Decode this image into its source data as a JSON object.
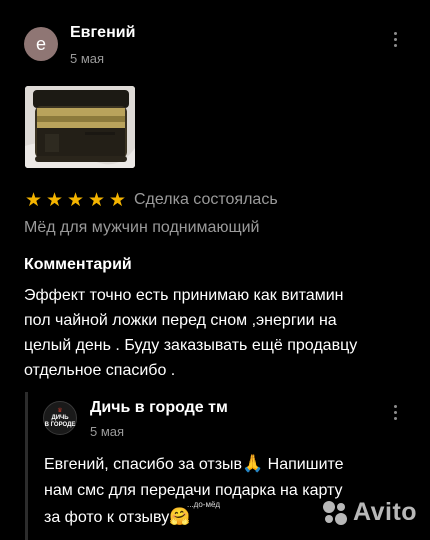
{
  "review": {
    "avatar_letter": "е",
    "author": "Евгений",
    "date": "5 мая",
    "rating": 5,
    "deal_status": "Сделка состоялась",
    "product": "Мёд для мужчин поднимающий",
    "comment_heading": "Комментарий",
    "comment_lines": [
      "Эффект точно есть принимаю как витамин",
      "пол чайной ложки перед сном ,энергии на",
      "целый день . Буду заказывать ещё продавцу",
      "отдельное спасибо ."
    ]
  },
  "reply": {
    "seller_logo_line1": "ДИЧЬ",
    "seller_logo_line2": "В ГОРОДЕ",
    "seller_name": "Дичь в городе тм",
    "date": "5 мая",
    "lines": [
      "Евгений, спасибо за отзыв",
      "нам смс для передачи подарка на карту",
      "за фото к отзыву"
    ],
    "line1_tail": " Напишите",
    "emoji_pray": "🙏",
    "emoji_hug": "🤗"
  },
  "watermarks": {
    "small": "...до-мёд",
    "brand": "Avito"
  },
  "colors": {
    "background": "#000000",
    "star": "#f4b400",
    "muted_text": "#9a9a9a",
    "avatar_bg": "#8f7674"
  },
  "icons": [
    "kebab-menu-icon",
    "star-icon",
    "avito-logo-icon"
  ]
}
